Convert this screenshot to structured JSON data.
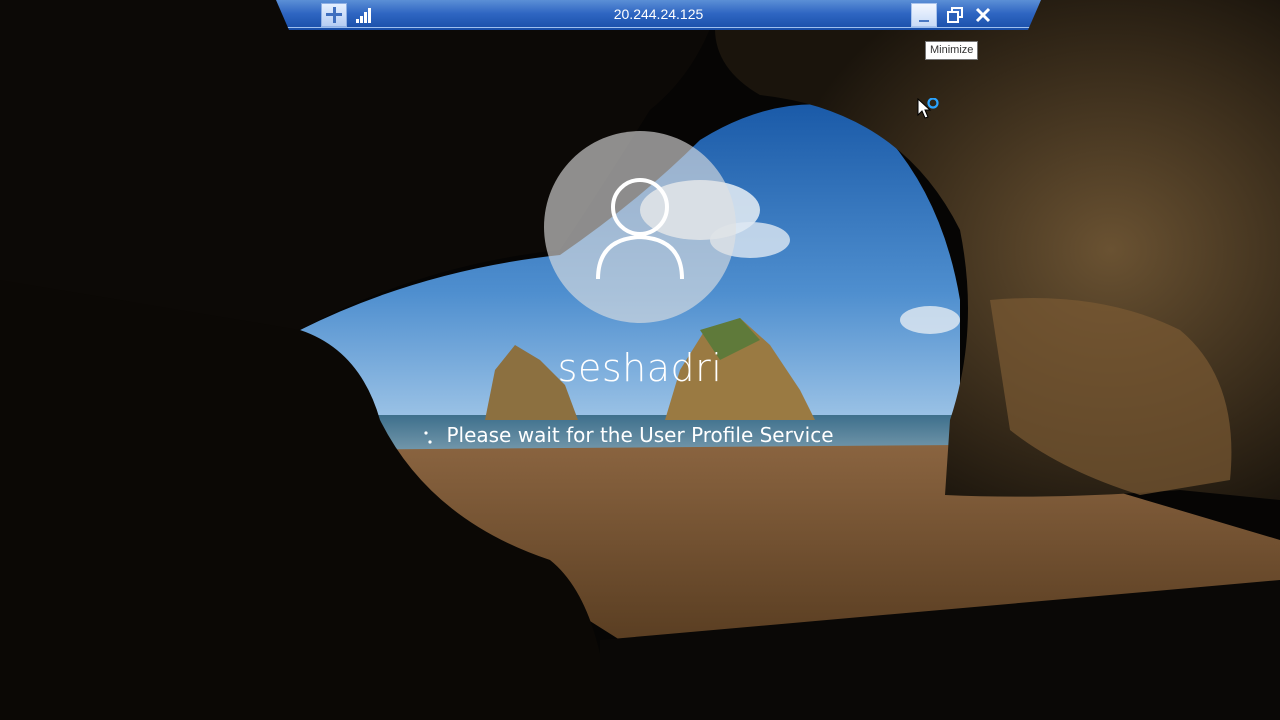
{
  "connection_bar": {
    "title": "20.244.24.125",
    "pin_icon": "pin-icon",
    "signal_icon": "signal-strength-icon",
    "minimize_icon": "minimize-icon",
    "restore_icon": "restore-icon",
    "close_icon": "close-icon"
  },
  "tooltip": {
    "text": "Minimize"
  },
  "login": {
    "avatar_icon": "user-icon",
    "username": "seshadri",
    "status": "Please wait for the User Profile Service"
  },
  "colors": {
    "bar_top": "#5b8fd6",
    "bar_bottom": "#184ea8",
    "text": "#ffffff",
    "busy_ring": "#2aa3ff"
  }
}
